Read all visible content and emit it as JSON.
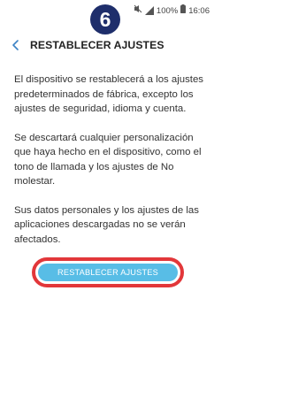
{
  "status_bar": {
    "battery": "100%",
    "time": "16:06",
    "icons": [
      "mute-icon",
      "signal-icon",
      "battery-icon"
    ]
  },
  "step_badge": "6",
  "header": {
    "title": "RESTABLECER AJUSTES"
  },
  "body": {
    "paragraph_1": "El dispositivo se restablecerá a los ajustes predeterminados de fábrica, excepto los ajustes de seguridad, idioma y cuenta.",
    "paragraph_2": "Se descartará cualquier personalización que haya hecho en el dispositivo, como el tono de llamada y los ajustes de No molestar.",
    "paragraph_3": "Sus datos personales y los ajustes de las aplicaciones descargadas no se verán afectados."
  },
  "reset_button_label": "RESTABLECER AJUSTES",
  "colors": {
    "badge": "#1e2e6b",
    "button": "#58bde6",
    "highlight": "#e2373a",
    "back_arrow": "#3b82c4"
  }
}
